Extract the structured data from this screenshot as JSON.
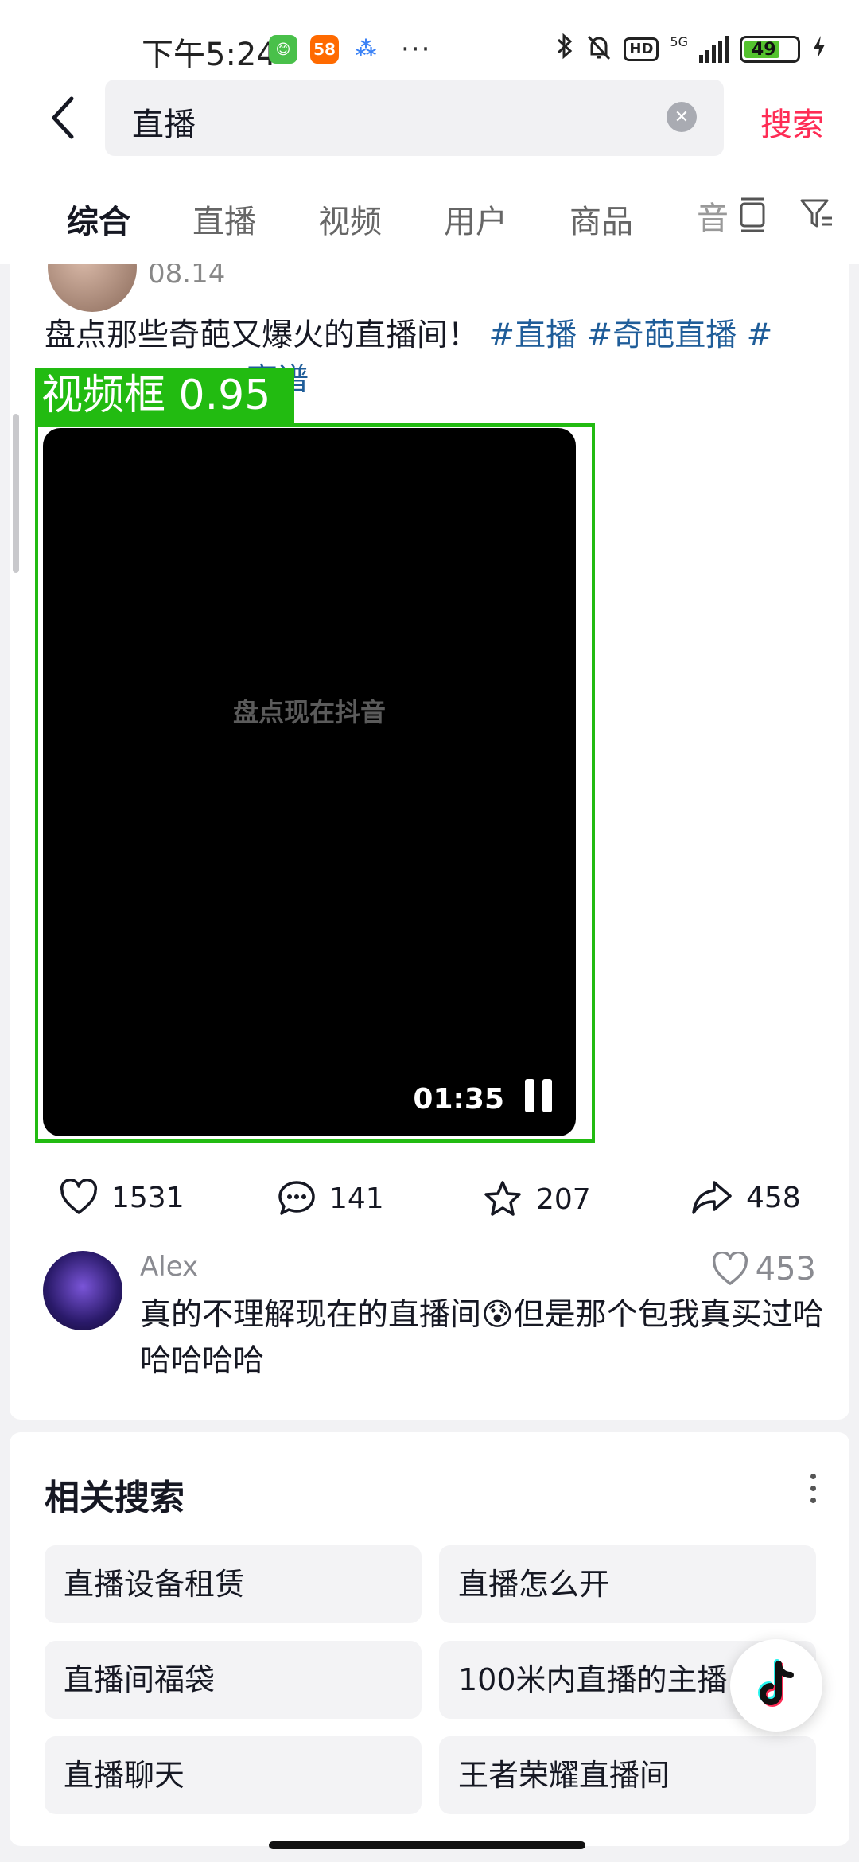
{
  "status_bar": {
    "time": "下午5:24",
    "app_badges": [
      "😊",
      "58",
      "⁂"
    ],
    "more": "···",
    "network": "5G",
    "hd_label": "HD",
    "battery": "49"
  },
  "search": {
    "query": "直播",
    "search_button": "搜索"
  },
  "tabs": [
    {
      "label": "综合",
      "active": true
    },
    {
      "label": "直播",
      "active": false
    },
    {
      "label": "视频",
      "active": false
    },
    {
      "label": "用户",
      "active": false
    },
    {
      "label": "商品",
      "active": false
    },
    {
      "label": "音",
      "active": false
    }
  ],
  "post": {
    "date": "08.14",
    "description": "盘点那些奇葩又爆火的直播间！",
    "tags": [
      "#直播",
      "#奇葩直播",
      "#"
    ],
    "tag_line2": "离谱",
    "detection_label": "视频框 0.95",
    "watermark": "盘点现在抖音",
    "duration": "01:35",
    "likes": "1531",
    "comments": "141",
    "favorites": "207",
    "shares": "458"
  },
  "top_comment": {
    "user": "Alex",
    "likes": "453",
    "text": "真的不理解现在的直播间😰但是那个包我真买过哈哈哈哈哈"
  },
  "related": {
    "title": "相关搜索",
    "items": [
      "直播设备租赁",
      "直播怎么开",
      "直播间福袋",
      "100米内直播的主播",
      "直播聊天",
      "王者荣耀直播间"
    ]
  },
  "colors": {
    "accent": "#fe2c55",
    "tag": "#1f5d99",
    "detection": "#22bb11"
  }
}
